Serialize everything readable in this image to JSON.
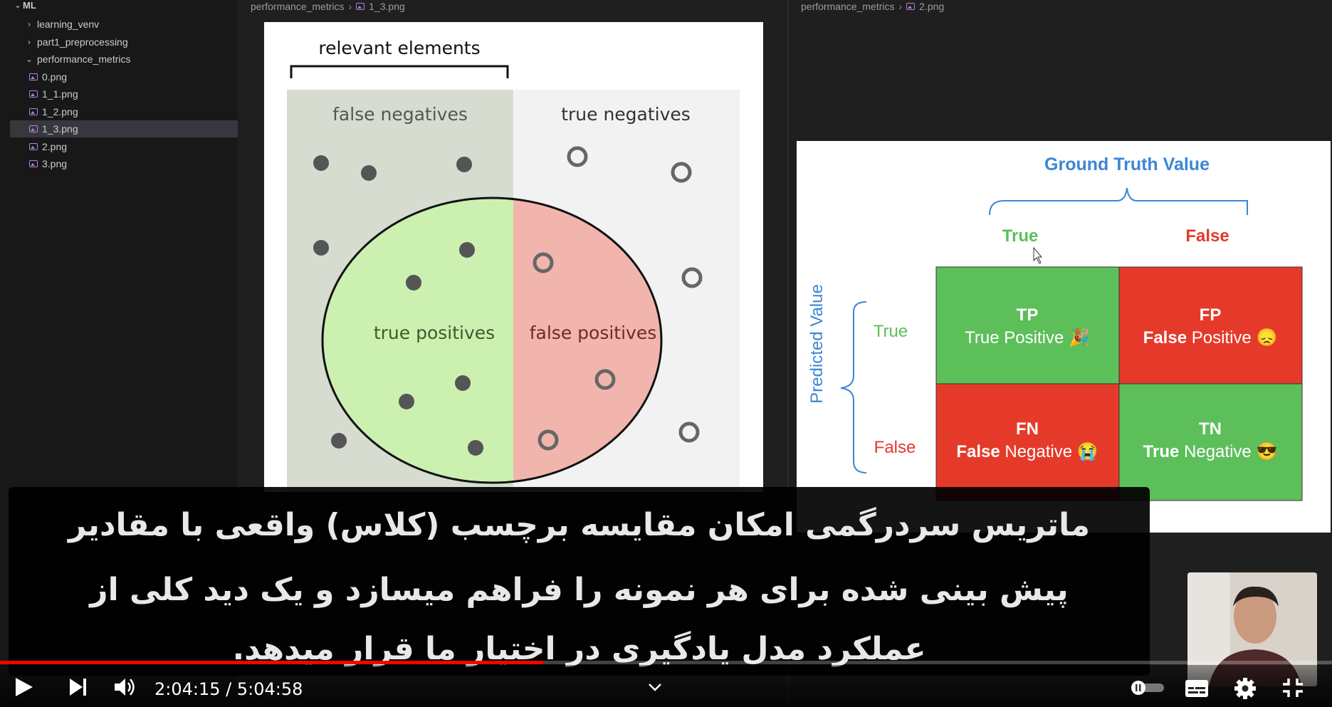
{
  "sidebar": {
    "root": "ML",
    "items": [
      {
        "label": "learning_venv",
        "kind": "folder",
        "expanded": false
      },
      {
        "label": "part1_preprocessing",
        "kind": "folder",
        "expanded": false
      },
      {
        "label": "performance_metrics",
        "kind": "folder",
        "expanded": true
      },
      {
        "label": "0.png",
        "kind": "file"
      },
      {
        "label": "1_1.png",
        "kind": "file"
      },
      {
        "label": "1_2.png",
        "kind": "file"
      },
      {
        "label": "1_3.png",
        "kind": "file",
        "selected": true
      },
      {
        "label": "2.png",
        "kind": "file"
      },
      {
        "label": "3.png",
        "kind": "file"
      }
    ]
  },
  "left_pane": {
    "breadcrumb": [
      "performance_metrics",
      "1_3.png"
    ],
    "figure": {
      "title": "relevant elements",
      "false_negatives": "false negatives",
      "true_negatives": "true negatives",
      "true_positives": "true positives",
      "false_positives": "false positives"
    }
  },
  "right_pane": {
    "breadcrumb": [
      "performance_metrics",
      "2.png"
    ],
    "matrix": {
      "ground_truth_label": "Ground Truth Value",
      "predicted_label": "Predicted Value",
      "col_true": "True",
      "col_false": "False",
      "row_true": "True",
      "row_false": "False",
      "tp_abbr": "TP",
      "tp_full_a": "True",
      "tp_full_b": "Positive",
      "tp_emoji": "🎉",
      "fp_abbr": "FP",
      "fp_full_a": "False",
      "fp_full_b": "Positive",
      "fp_emoji": "😞",
      "fn_abbr": "FN",
      "fn_full_a": "False",
      "fn_full_b": "Negative",
      "fn_emoji": "😭",
      "tn_abbr": "TN",
      "tn_full_a": "True",
      "tn_full_b": "Negative",
      "tn_emoji": "😎"
    }
  },
  "subtitle": {
    "line1": "ماتریس سردرگمی امکان مقایسه برچسب (کلاس) واقعی با مقادیر",
    "line2": "پیش بینی شده برای هر نمونه را فراهم میسازد و یک دید کلی از",
    "line3": "عملکرد مدل یادگیری در اختیار ما قرار میدهد."
  },
  "player": {
    "time_text": "2:04:15 / 5:04:58",
    "progress_fraction": 0.408,
    "accent": "#ff0000",
    "icons": [
      "play-icon",
      "next-icon",
      "volume-icon",
      "chevron-down-icon",
      "autoplay-toggle-icon",
      "subtitles-icon",
      "settings-icon",
      "exit-fullscreen-icon"
    ]
  },
  "colors": {
    "fn_region": "#d6dccf",
    "tn_region": "#f2f2f2",
    "tp_region": "#ccf0b0",
    "fp_region": "#f2b5ad",
    "cell_green": "#5cbf5a",
    "cell_red": "#e53a2a",
    "gt_blue": "#3b86d6"
  }
}
